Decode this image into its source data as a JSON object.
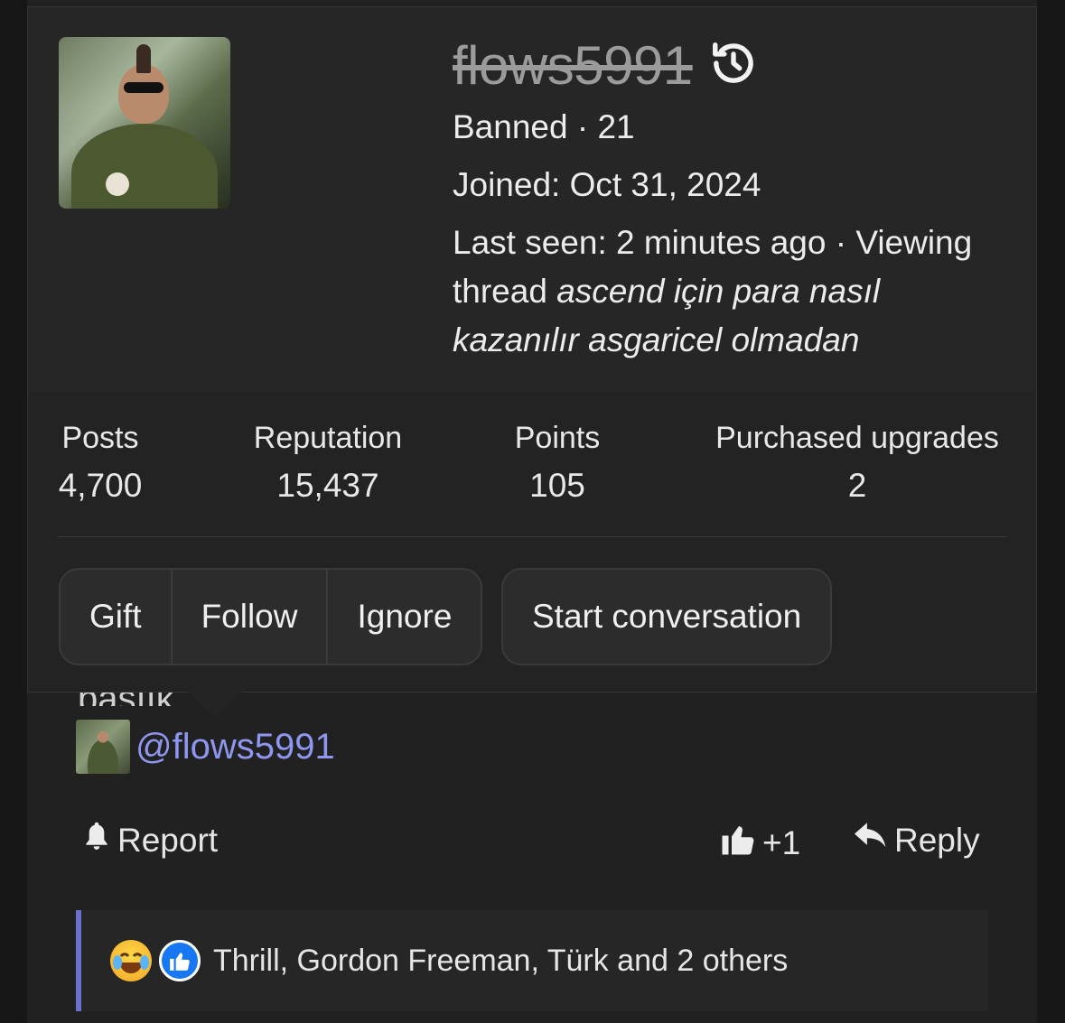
{
  "popup": {
    "username": "flows5991",
    "status_line": "Banned · 21",
    "joined": "Joined: Oct 31, 2024",
    "last_seen_prefix": "Last seen: 2 minutes ago · Viewing",
    "last_seen_thread_word": "thread",
    "thread_title_line1": "ascend için para nasıl",
    "thread_title_line2": "kazanılır asgaricel olmadan",
    "stats": [
      {
        "label": "Posts",
        "value": "4,700"
      },
      {
        "label": "Reputation",
        "value": "15,437"
      },
      {
        "label": "Points",
        "value": "105"
      },
      {
        "label": "Purchased upgrades",
        "value": "2"
      }
    ],
    "buttons": {
      "gift": "Gift",
      "follow": "Follow",
      "ignore": "Ignore",
      "start_conversation": "Start conversation"
    }
  },
  "post": {
    "partial_text": "basıık",
    "mention": "@flows5991",
    "report_label": "Report",
    "like_count": "+1",
    "reply_label": "Reply",
    "reactions_summary": "Thrill, Gordon Freeman, Türk and 2 others"
  },
  "colors": {
    "accent": "#8e96f0",
    "reaction_bar_border": "#6a6fd0",
    "background": "#212121"
  },
  "icons": [
    "history-icon",
    "bell-icon",
    "thumbs-up-icon",
    "reply-icon",
    "laugh-cry-emoji",
    "like-reaction-icon"
  ]
}
